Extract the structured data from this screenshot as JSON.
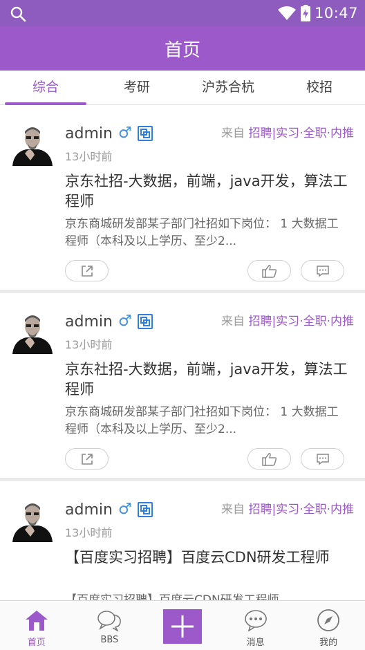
{
  "status_bar": {
    "time": "10:47"
  },
  "app_bar": {
    "title": "首页"
  },
  "tabs": [
    {
      "label": "综合",
      "active": true
    },
    {
      "label": "考研",
      "active": false
    },
    {
      "label": "沪苏合杭",
      "active": false
    },
    {
      "label": "校招",
      "active": false
    }
  ],
  "posts": [
    {
      "author": "admin",
      "gender": "♂",
      "time": "13小时前",
      "source_prefix": "来自",
      "source_category": "招聘|实习·全职·内推",
      "title": "京东社招-大数据，前端，java开发，算法工程师",
      "excerpt": "京东商城研发部某子部门社招如下岗位： 1 大数据工程师（本科及以上学历、至少2..."
    },
    {
      "author": "admin",
      "gender": "♂",
      "time": "13小时前",
      "source_prefix": "来自",
      "source_category": "招聘|实习·全职·内推",
      "title": "京东社招-大数据，前端，java开发，算法工程师",
      "excerpt": "京东商城研发部某子部门社招如下岗位： 1 大数据工程师（本科及以上学历、至少2..."
    },
    {
      "author": "admin",
      "gender": "♂",
      "time": "13小时前",
      "source_prefix": "来自",
      "source_category": "招聘|实习·全职·内推",
      "title": "【百度实习招聘】百度云CDN研发工程师",
      "excerpt": "【百度实习招聘】百度云CDN研发工程师"
    }
  ],
  "bottom_nav": {
    "home": "首页",
    "bbs": "BBS",
    "messages": "消息",
    "mine": "我的"
  },
  "colors": {
    "accent": "#9b59c9",
    "status_bar": "#8e5bbf",
    "badge_blue": "#2f7fe0"
  }
}
